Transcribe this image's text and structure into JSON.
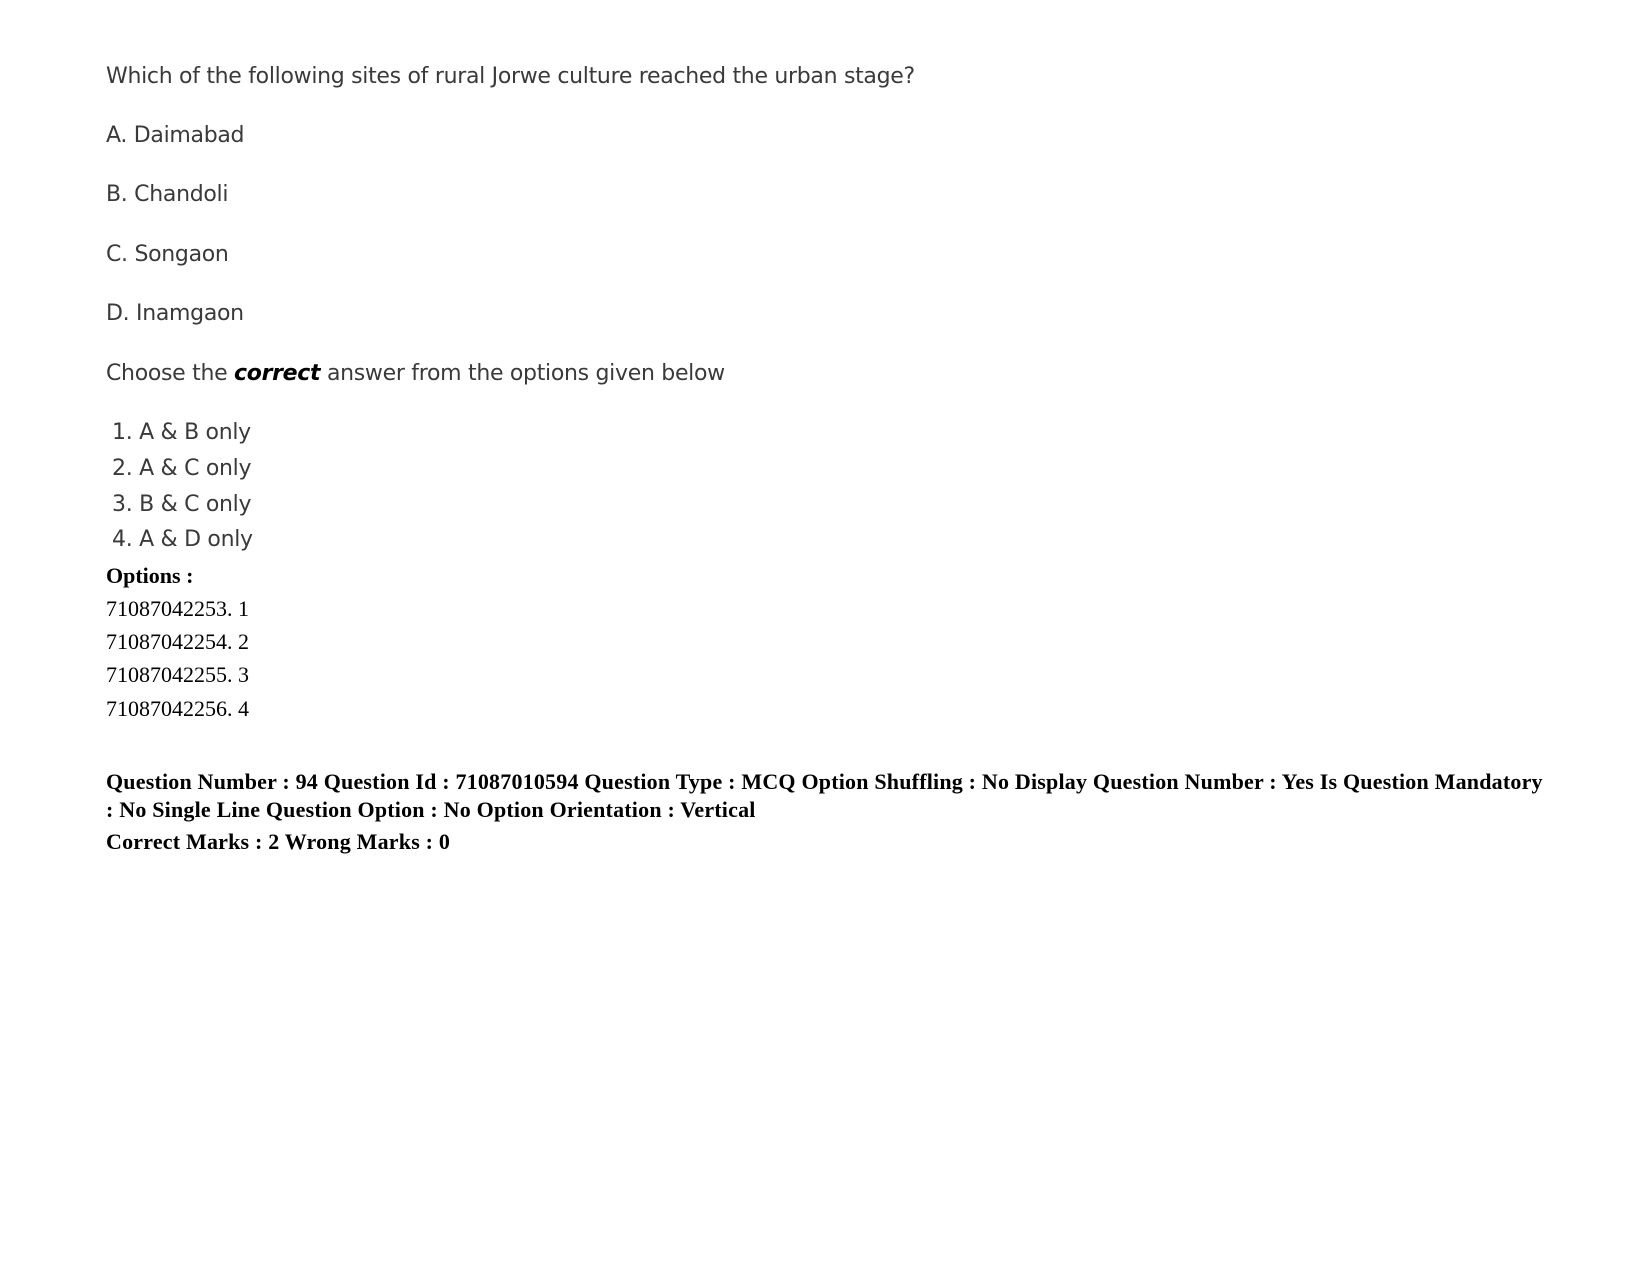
{
  "question": {
    "text": "Which of the following sites of rural Jorwe culture reached the urban stage?",
    "statements": [
      {
        "label": "A. Daimabad"
      },
      {
        "label": "B. Chandoli"
      },
      {
        "label": "C. Songaon"
      },
      {
        "label": "D. Inamgaon"
      }
    ],
    "instruction": {
      "prefix": "Choose the ",
      "emphasis": "correct",
      "suffix": " answer from the options given below"
    },
    "choices": [
      {
        "label": "1. A & B only"
      },
      {
        "label": "2. A & C only"
      },
      {
        "label": "3. B & C only"
      },
      {
        "label": "4. A & D only"
      }
    ]
  },
  "options": {
    "heading": "Options :",
    "items": [
      {
        "label": "71087042253. 1"
      },
      {
        "label": "71087042254. 2"
      },
      {
        "label": "71087042255. 3"
      },
      {
        "label": "71087042256. 4"
      }
    ]
  },
  "metadata": {
    "line1": "Question Number : 94 Question Id : 71087010594 Question Type : MCQ Option Shuffling : No Display Question Number : Yes Is Question Mandatory : No Single Line Question Option : No Option Orientation : Vertical",
    "line2": "Correct Marks : 2 Wrong Marks : 0"
  }
}
